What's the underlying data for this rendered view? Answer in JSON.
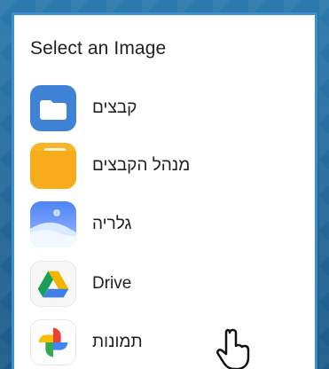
{
  "dialog": {
    "title": "Select an Image"
  },
  "items": [
    {
      "label": "קבצים",
      "icon": "folder-icon"
    },
    {
      "label": "מנהל הקבצים",
      "icon": "file-manager-icon"
    },
    {
      "label": "גלריה",
      "icon": "gallery-icon"
    },
    {
      "label": "Drive",
      "icon": "google-drive-icon"
    },
    {
      "label": "תמונות",
      "icon": "google-photos-icon"
    }
  ]
}
